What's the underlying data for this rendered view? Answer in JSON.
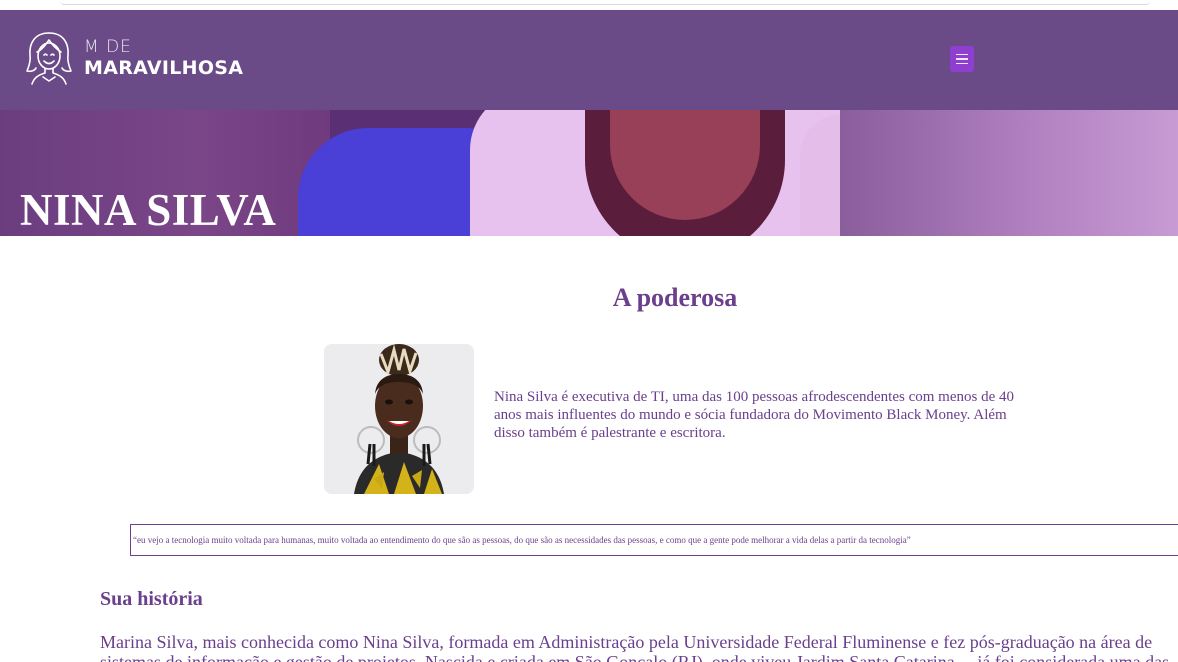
{
  "header": {
    "logo_small": "M DE",
    "logo_big": "MARAVILHOSA",
    "menu_icon": "hamburger-menu-icon"
  },
  "hero": {
    "title": "NINA SILVA"
  },
  "main": {
    "section_title": "A poderosa",
    "bio": "Nina Silva é executiva de TI, uma das 100 pessoas afrodescendentes com menos de 40 anos mais influentes do mundo e sócia fundadora do Movimento Black Money. Além disso também é palestrante e escritora.",
    "quote": "“eu vejo a tecnologia muito voltada para humanas, muito voltada ao entendimento do que são as pessoas, do que são as necessidades das pessoas, e como que a gente pode melhorar a vida delas a partir da tecnologia”",
    "history_title": "Sua história",
    "history_text": "Marina Silva, mais conhecida como Nina Silva, formada em Administração pela Universidade Federal Fluminense e fez pós-graduação na área de sistemas de informação e gestão de projetos. Nascida e criada em São Gonçalo (RJ), onde viveu Jardim Santa Catarina, ...já foi considerada uma das fundadoras"
  },
  "colors": {
    "brand_purple": "#6a4a87",
    "text_purple": "#6a3f8d",
    "menu_button": "#8e3fd0"
  }
}
